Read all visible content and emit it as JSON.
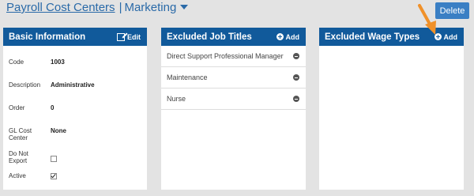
{
  "breadcrumb": {
    "parent": "Payroll Cost Centers",
    "separator": "|",
    "current": "Marketing"
  },
  "toolbar": {
    "delete_label": "Delete"
  },
  "basic_info": {
    "title": "Basic Information",
    "edit_label": "Edit",
    "fields": {
      "code": {
        "label": "Code",
        "value": "1003"
      },
      "description": {
        "label": "Description",
        "value": "Administrative"
      },
      "order": {
        "label": "Order",
        "value": "0"
      },
      "gl_cost_center": {
        "label": "GL Cost Center",
        "value": "None"
      },
      "do_not_export": {
        "label": "Do Not Export",
        "checked": false
      },
      "active": {
        "label": "Active",
        "checked": true
      }
    }
  },
  "excluded_job_titles": {
    "title": "Excluded Job Titles",
    "add_label": "Add",
    "items": [
      "Direct Support Professional Manager",
      "Maintenance",
      "Nurse"
    ]
  },
  "excluded_wage_types": {
    "title": "Excluded Wage Types",
    "add_label": "Add",
    "items": []
  },
  "colors": {
    "panel_header": "#115a9b",
    "accent_button": "#3a7fc4",
    "background": "#e3e3e3",
    "annotation_arrow": "#f0912a"
  }
}
